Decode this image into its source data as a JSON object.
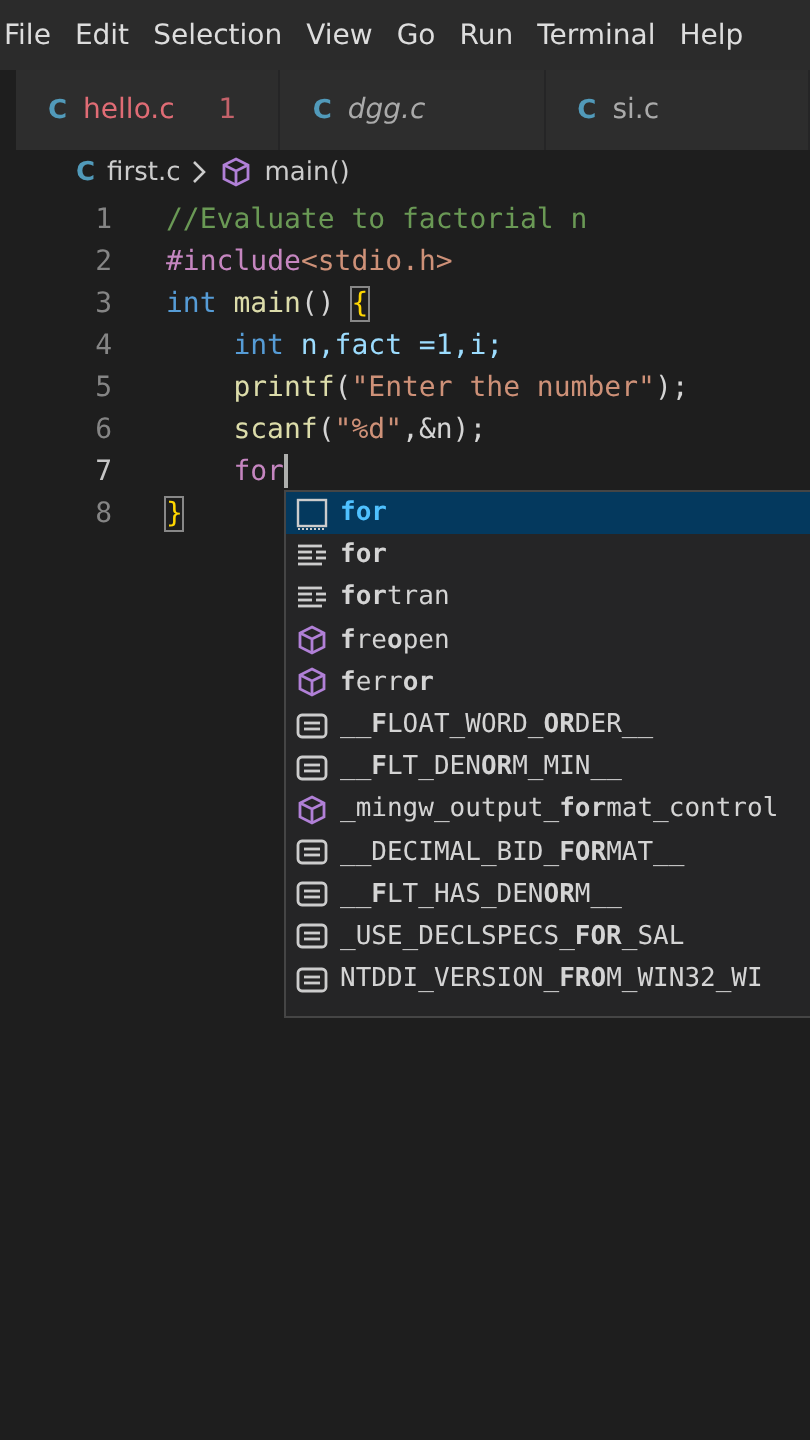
{
  "menu": [
    "File",
    "Edit",
    "Selection",
    "View",
    "Go",
    "Run",
    "Terminal",
    "Help"
  ],
  "tabs": [
    {
      "icon": "C",
      "name": "hello.c",
      "problems": "1",
      "preview": false,
      "error": true
    },
    {
      "icon": "C",
      "name": "dgg.c",
      "preview": true,
      "error": false
    },
    {
      "icon": "C",
      "name": "si.c",
      "preview": false,
      "error": false
    }
  ],
  "breadcrumb": {
    "icon": "C",
    "file": "first.c",
    "symbol": "main()"
  },
  "lines": [
    {
      "number": "1",
      "active": false,
      "indented": false,
      "tokens": [
        {
          "kind": "comment",
          "text": "//Evaluate to factorial n"
        }
      ]
    },
    {
      "number": "2",
      "active": false,
      "indented": false,
      "tokens": [
        {
          "kind": "preproc",
          "text": "#include"
        },
        {
          "kind": "string",
          "text": "<stdio.h>"
        }
      ]
    },
    {
      "number": "3",
      "active": false,
      "indented": false,
      "tokens": [
        {
          "kind": "keyword",
          "text": "int"
        },
        {
          "kind": "func",
          "text": " main"
        },
        {
          "kind": "plain",
          "text": "() "
        },
        {
          "kind": "bracket",
          "text": "{"
        }
      ]
    },
    {
      "number": "4",
      "active": false,
      "indented": true,
      "tokens": [
        {
          "kind": "keyword",
          "text": "int"
        },
        {
          "kind": "var",
          "text": " n,fact =1,i;"
        }
      ]
    },
    {
      "number": "5",
      "active": false,
      "indented": true,
      "tokens": [
        {
          "kind": "func",
          "text": "printf"
        },
        {
          "kind": "plain",
          "text": "("
        },
        {
          "kind": "string",
          "text": "\"Enter the number\""
        },
        {
          "kind": "plain",
          "text": ");"
        }
      ]
    },
    {
      "number": "6",
      "active": false,
      "indented": true,
      "tokens": [
        {
          "kind": "func",
          "text": "scanf"
        },
        {
          "kind": "plain",
          "text": "("
        },
        {
          "kind": "string",
          "text": "\"%d\""
        },
        {
          "kind": "plain",
          "text": ",&n);"
        }
      ]
    },
    {
      "number": "7",
      "active": true,
      "indented": true,
      "tokens": [
        {
          "kind": "control",
          "text": "for"
        }
      ]
    },
    {
      "number": "8",
      "active": false,
      "indented": false,
      "tokens": [
        {
          "kind": "bracket",
          "text": "}"
        }
      ]
    }
  ],
  "suggestions": [
    {
      "kind": "keyword",
      "label": "**for**",
      "selected": true
    },
    {
      "kind": "snippet",
      "label": "**for**",
      "selected": false
    },
    {
      "kind": "snippet",
      "label": "**for**tran",
      "selected": false
    },
    {
      "kind": "method",
      "label": "**f**re**o**pen",
      "selected": false
    },
    {
      "kind": "method",
      "label": "**f**err**or**",
      "selected": false
    },
    {
      "kind": "constant",
      "label": "__**F**LOAT_WORD_**OR**DER__",
      "selected": false
    },
    {
      "kind": "constant",
      "label": "__**F**LT_DEN**OR**M_MIN__",
      "selected": false
    },
    {
      "kind": "method",
      "label": "_mingw_output_**for**mat_control",
      "selected": false
    },
    {
      "kind": "constant",
      "label": "__DECIMAL_BID_**FOR**MAT__",
      "selected": false
    },
    {
      "kind": "constant",
      "label": "__**F**LT_HAS_DEN**OR**M__",
      "selected": false
    },
    {
      "kind": "constant",
      "label": "_USE_DECLSPECS_**FOR**_SAL",
      "selected": false
    },
    {
      "kind": "constant",
      "label": "NTDDI_VERSION_**FRO**M_WIN32_WI",
      "selected": false
    }
  ]
}
